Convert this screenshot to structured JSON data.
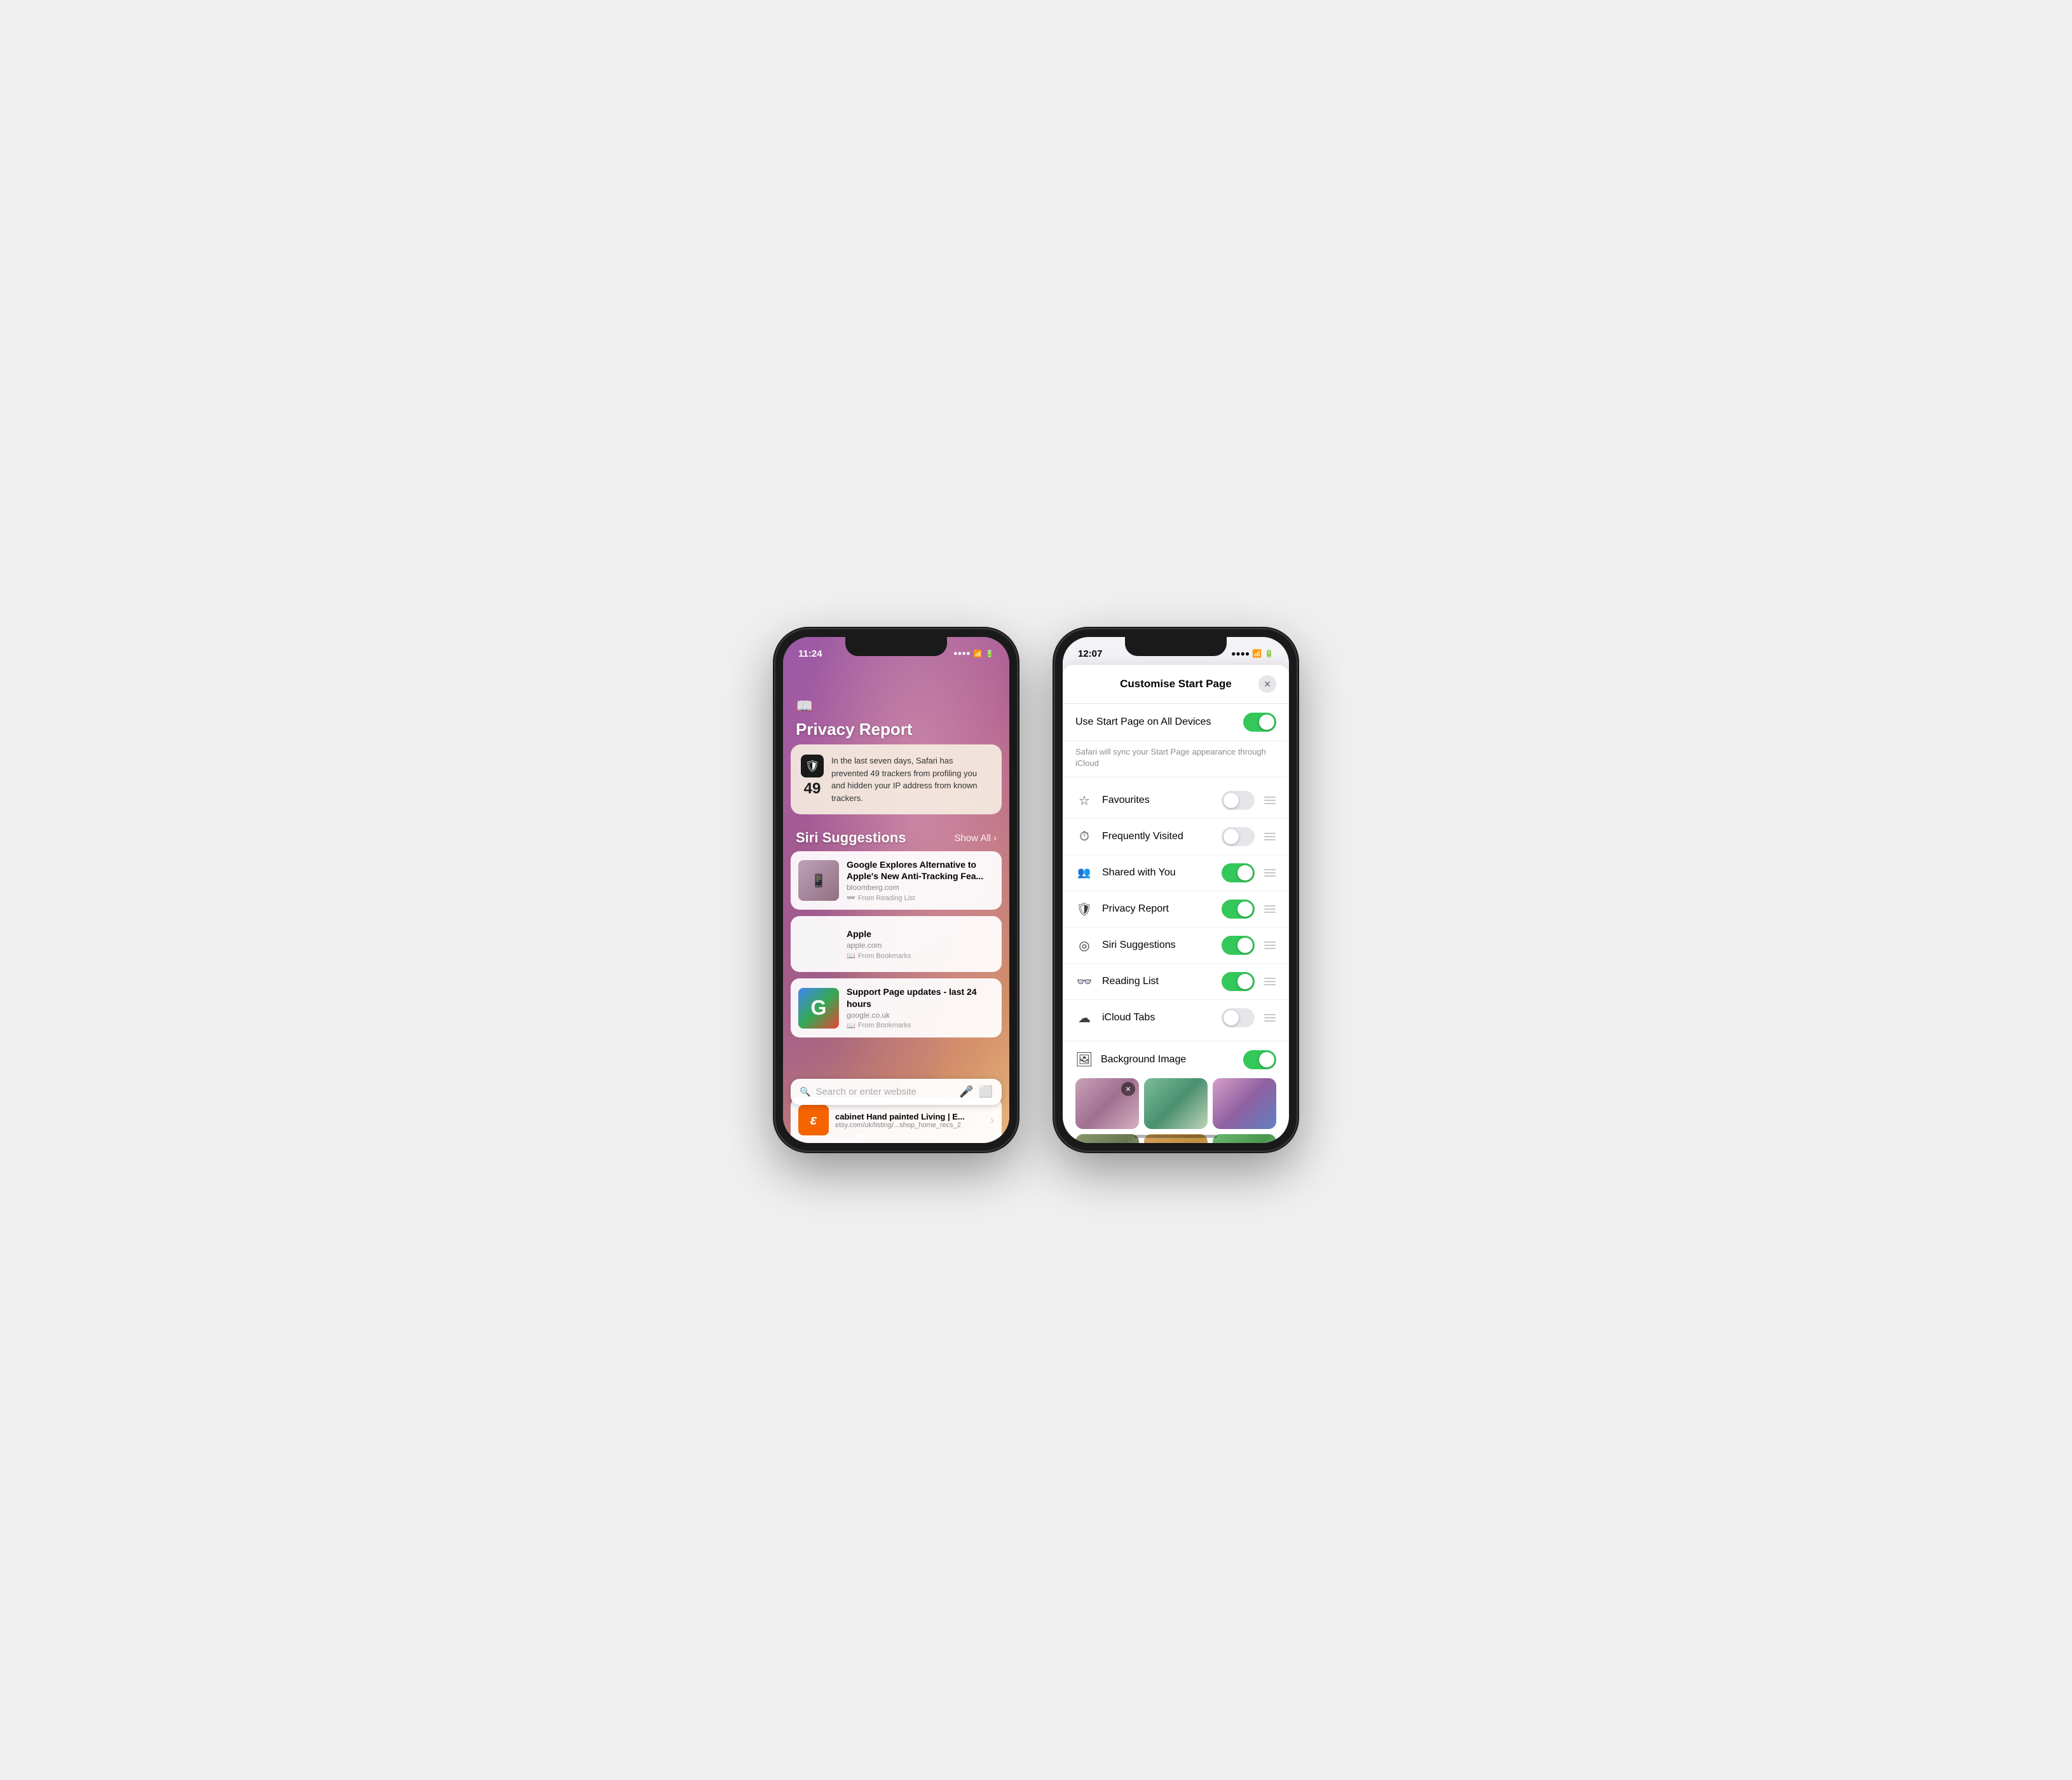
{
  "phone1": {
    "status": {
      "time": "11:24",
      "signal": "●●●●",
      "wifi": "WiFi",
      "battery": "⚡"
    },
    "bookIcon": "📖",
    "privacyReport": {
      "title": "Privacy Report",
      "count": "49",
      "shieldIcon": "🛡",
      "text": "In the last seven days, Safari has prevented 49 trackers from profiling you and hidden your IP address from known trackers."
    },
    "siriSuggestions": {
      "title": "Siri Suggestions",
      "showAll": "Show All"
    },
    "cards": [
      {
        "title": "Google Explores Alternative to Apple's New Anti-Tracking Fea...",
        "domain": "bloomberg.com",
        "source": "From Reading List",
        "sourceIcon": "👓"
      },
      {
        "title": "Apple",
        "domain": "apple.com",
        "source": "From Bookmarks",
        "sourceIcon": "📖"
      },
      {
        "title": "Support Page updates - last 24 hours",
        "domain": "google.co.uk",
        "source": "From Bookmarks",
        "sourceIcon": "📖"
      }
    ],
    "searchPlaceholder": "Search or enter website",
    "bottomCard": {
      "title": "cabinet Hand painted Living | E...",
      "domain": "etsy.com/uk/listing/...shop_home_recs_2",
      "icon": "ε"
    }
  },
  "phone2": {
    "status": {
      "time": "12:07",
      "signal": "●●●●",
      "wifi": "WiFi",
      "battery": "⚡"
    },
    "modal": {
      "title": "Customise Start Page",
      "closeLabel": "✕"
    },
    "useStartPage": {
      "label": "Use Start Page on All Devices",
      "enabled": true,
      "subtitle": "Safari will sync your Start Page appearance through iCloud"
    },
    "settings": [
      {
        "icon": "☆",
        "label": "Favourites",
        "enabled": false
      },
      {
        "icon": "⏱",
        "label": "Frequently Visited",
        "enabled": false
      },
      {
        "icon": "👥",
        "label": "Shared with You",
        "enabled": true
      },
      {
        "icon": "🛡",
        "label": "Privacy Report",
        "enabled": true
      },
      {
        "icon": "◎",
        "label": "Siri Suggestions",
        "enabled": true
      },
      {
        "icon": "👓",
        "label": "Reading List",
        "enabled": true
      },
      {
        "icon": "☁",
        "label": "iCloud Tabs",
        "enabled": false
      }
    ],
    "backgroundImage": {
      "label": "Background Image",
      "icon": "🖼",
      "enabled": true
    },
    "bgThumbs": [
      {
        "selected": true,
        "style": "thumb-1"
      },
      {
        "selected": false,
        "style": "thumb-2"
      },
      {
        "selected": false,
        "style": "thumb-3"
      },
      {
        "selected": false,
        "style": "thumb-4"
      },
      {
        "selected": false,
        "style": "thumb-5"
      },
      {
        "selected": false,
        "style": "thumb-6"
      }
    ]
  }
}
